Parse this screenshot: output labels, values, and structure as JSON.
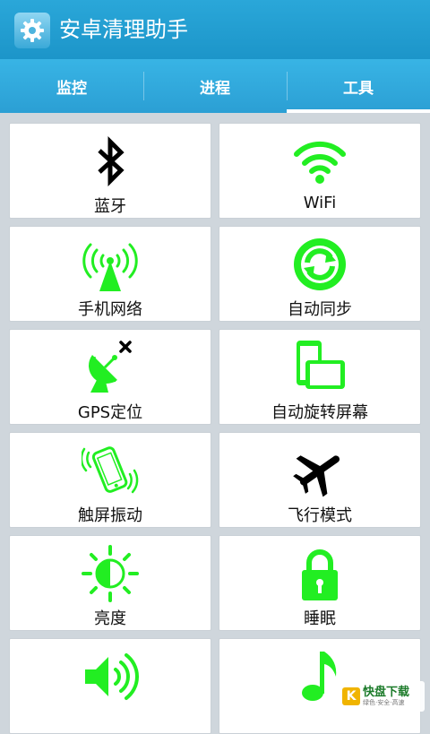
{
  "app": {
    "title": "安卓清理助手",
    "icon": "gear-icon"
  },
  "tabs": [
    {
      "label": "监控",
      "active": false
    },
    {
      "label": "进程",
      "active": false
    },
    {
      "label": "工具",
      "active": true
    }
  ],
  "tools": [
    {
      "label": "蓝牙",
      "icon": "bluetooth-icon",
      "color": "#000000"
    },
    {
      "label": "WiFi",
      "icon": "wifi-icon",
      "color": "#22ee22"
    },
    {
      "label": "手机网络",
      "icon": "cell-tower-icon",
      "color": "#22ee22"
    },
    {
      "label": "自动同步",
      "icon": "sync-icon",
      "color": "#22ee22"
    },
    {
      "label": "GPS定位",
      "icon": "satellite-dish-icon",
      "color": "#22ee22"
    },
    {
      "label": "自动旋转屏幕",
      "icon": "rotate-screen-icon",
      "color": "#22ee22"
    },
    {
      "label": "触屏振动",
      "icon": "vibrate-icon",
      "color": "#22ee22"
    },
    {
      "label": "飞行模式",
      "icon": "airplane-icon",
      "color": "#000000"
    },
    {
      "label": "亮度",
      "icon": "brightness-icon",
      "color": "#22ee22"
    },
    {
      "label": "睡眠",
      "icon": "lock-icon",
      "color": "#22ee22"
    },
    {
      "label": "",
      "icon": "volume-icon",
      "color": "#22ee22"
    },
    {
      "label": "",
      "icon": "music-note-icon",
      "color": "#22ee22"
    }
  ],
  "watermark": {
    "brand": "快盘下载",
    "letter": "K",
    "tagline": "绿色·安全·高速"
  }
}
